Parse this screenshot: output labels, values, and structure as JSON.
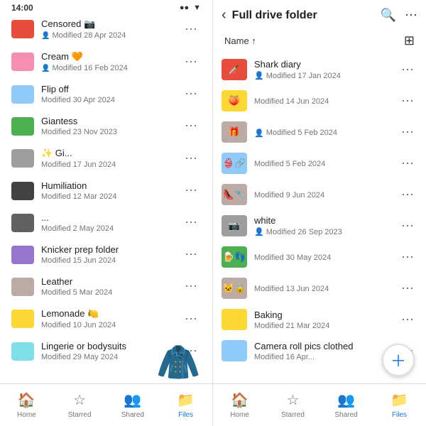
{
  "status_bar": {
    "time": "14:00",
    "signals": "●● ▼"
  },
  "left_panel": {
    "folders": [
      {
        "name": "Censored 📷",
        "meta": "Modified 28 Apr 2024",
        "shared": true,
        "color": "folder-red"
      },
      {
        "name": "Cream 🧡",
        "meta": "Modified 16 Feb 2024",
        "shared": true,
        "color": "folder-pink"
      },
      {
        "name": "Flip off",
        "meta": "Modified 30 Apr 2024",
        "shared": false,
        "color": "folder-blue-light"
      },
      {
        "name": "Giantess",
        "meta": "Modified 23 Nov 2023",
        "shared": false,
        "color": "folder-green"
      },
      {
        "name": "✨ Gi...",
        "meta": "Modified 17 Jun 2024",
        "shared": false,
        "color": "folder-gray"
      },
      {
        "name": "Humiliation",
        "meta": "Modified 12 Mar 2024",
        "shared": false,
        "color": "folder-dark"
      },
      {
        "name": "...",
        "meta": "Modified 2 May 2024",
        "shared": false,
        "color": "folder-dark2"
      },
      {
        "name": "Knicker prep folder",
        "meta": "Modified 15 Jun 2024",
        "shared": false,
        "color": "folder-purple"
      },
      {
        "name": "Leather",
        "meta": "Modified 5 Mar 2024",
        "shared": false,
        "color": "folder-tan"
      },
      {
        "name": "Lemonade 🍋",
        "meta": "Modified 10 Jun 2024",
        "shared": false,
        "color": "folder-yellow"
      },
      {
        "name": "Lingerie or bodysuits",
        "meta": "Modified 29 May 2024",
        "shared": false,
        "color": "folder-cyan"
      }
    ],
    "nav": [
      {
        "label": "Home",
        "icon": "🏠",
        "active": false
      },
      {
        "label": "Starred",
        "icon": "☆",
        "active": false
      },
      {
        "label": "Shared",
        "icon": "👥",
        "active": false
      },
      {
        "label": "Files",
        "icon": "📁",
        "active": true
      }
    ]
  },
  "right_panel": {
    "title": "Full drive folder",
    "sort_label": "Name ↑",
    "items": [
      {
        "name": "Shark diary",
        "emoji": "🗡️",
        "meta": "Modified 17 Jan 2024",
        "shared": true,
        "color": "folder-red"
      },
      {
        "name": "",
        "emoji": "🍑",
        "meta": "Modified 14 Jun 2024",
        "shared": false,
        "color": "folder-yellow"
      },
      {
        "name": "",
        "emoji": "🎁",
        "meta": "Modified 5 Feb 2024",
        "shared": true,
        "color": "folder-tan"
      },
      {
        "name": "",
        "emoji": "👙🔗",
        "meta": "Modified 5 Feb 2024",
        "shared": false,
        "color": "folder-blue-light"
      },
      {
        "name": "",
        "emoji": "👠🔧",
        "meta": "Modified 9 Jun 2024",
        "shared": false,
        "color": "folder-tan"
      },
      {
        "name": "white",
        "emoji": "📷",
        "meta": "Modified 26 Sep 2023",
        "shared": true,
        "color": "folder-gray"
      },
      {
        "name": "",
        "emoji": "🍺👣",
        "meta": "Modified 30 May 2024",
        "shared": false,
        "color": "folder-green"
      },
      {
        "name": "",
        "emoji": "🐱🔒",
        "meta": "Modified 13 Jun 2024",
        "shared": false,
        "color": "folder-tan"
      },
      {
        "name": "Baking",
        "emoji": "",
        "meta": "Modified 21 Mar 2024",
        "shared": false,
        "color": "folder-yellow"
      },
      {
        "name": "Camera roll pics clothed",
        "emoji": "",
        "meta": "Modified 16 Apr...",
        "shared": false,
        "color": "folder-blue-light"
      }
    ],
    "nav": [
      {
        "label": "Home",
        "icon": "🏠",
        "active": false
      },
      {
        "label": "Starred",
        "icon": "☆",
        "active": false
      },
      {
        "label": "Shared",
        "icon": "👥",
        "active": false
      },
      {
        "label": "Files",
        "icon": "📁",
        "active": true
      }
    ]
  }
}
